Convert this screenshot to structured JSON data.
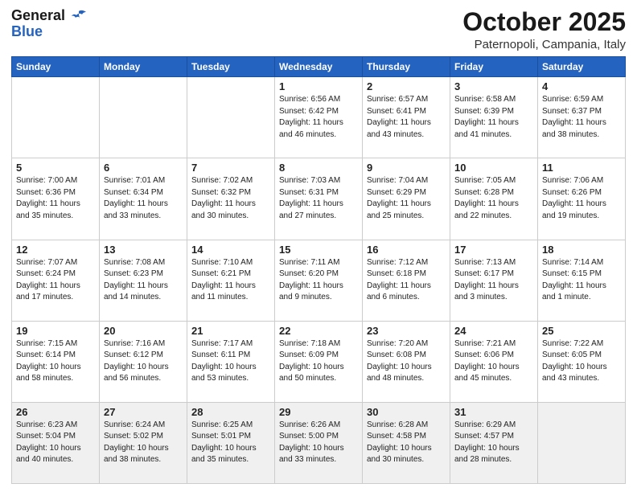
{
  "header": {
    "logo_general": "General",
    "logo_blue": "Blue",
    "month_title": "October 2025",
    "location": "Paternopoli, Campania, Italy"
  },
  "weekdays": [
    "Sunday",
    "Monday",
    "Tuesday",
    "Wednesday",
    "Thursday",
    "Friday",
    "Saturday"
  ],
  "weeks": [
    [
      {
        "day": "",
        "info": ""
      },
      {
        "day": "",
        "info": ""
      },
      {
        "day": "",
        "info": ""
      },
      {
        "day": "1",
        "info": "Sunrise: 6:56 AM\nSunset: 6:42 PM\nDaylight: 11 hours\nand 46 minutes."
      },
      {
        "day": "2",
        "info": "Sunrise: 6:57 AM\nSunset: 6:41 PM\nDaylight: 11 hours\nand 43 minutes."
      },
      {
        "day": "3",
        "info": "Sunrise: 6:58 AM\nSunset: 6:39 PM\nDaylight: 11 hours\nand 41 minutes."
      },
      {
        "day": "4",
        "info": "Sunrise: 6:59 AM\nSunset: 6:37 PM\nDaylight: 11 hours\nand 38 minutes."
      }
    ],
    [
      {
        "day": "5",
        "info": "Sunrise: 7:00 AM\nSunset: 6:36 PM\nDaylight: 11 hours\nand 35 minutes."
      },
      {
        "day": "6",
        "info": "Sunrise: 7:01 AM\nSunset: 6:34 PM\nDaylight: 11 hours\nand 33 minutes."
      },
      {
        "day": "7",
        "info": "Sunrise: 7:02 AM\nSunset: 6:32 PM\nDaylight: 11 hours\nand 30 minutes."
      },
      {
        "day": "8",
        "info": "Sunrise: 7:03 AM\nSunset: 6:31 PM\nDaylight: 11 hours\nand 27 minutes."
      },
      {
        "day": "9",
        "info": "Sunrise: 7:04 AM\nSunset: 6:29 PM\nDaylight: 11 hours\nand 25 minutes."
      },
      {
        "day": "10",
        "info": "Sunrise: 7:05 AM\nSunset: 6:28 PM\nDaylight: 11 hours\nand 22 minutes."
      },
      {
        "day": "11",
        "info": "Sunrise: 7:06 AM\nSunset: 6:26 PM\nDaylight: 11 hours\nand 19 minutes."
      }
    ],
    [
      {
        "day": "12",
        "info": "Sunrise: 7:07 AM\nSunset: 6:24 PM\nDaylight: 11 hours\nand 17 minutes."
      },
      {
        "day": "13",
        "info": "Sunrise: 7:08 AM\nSunset: 6:23 PM\nDaylight: 11 hours\nand 14 minutes."
      },
      {
        "day": "14",
        "info": "Sunrise: 7:10 AM\nSunset: 6:21 PM\nDaylight: 11 hours\nand 11 minutes."
      },
      {
        "day": "15",
        "info": "Sunrise: 7:11 AM\nSunset: 6:20 PM\nDaylight: 11 hours\nand 9 minutes."
      },
      {
        "day": "16",
        "info": "Sunrise: 7:12 AM\nSunset: 6:18 PM\nDaylight: 11 hours\nand 6 minutes."
      },
      {
        "day": "17",
        "info": "Sunrise: 7:13 AM\nSunset: 6:17 PM\nDaylight: 11 hours\nand 3 minutes."
      },
      {
        "day": "18",
        "info": "Sunrise: 7:14 AM\nSunset: 6:15 PM\nDaylight: 11 hours\nand 1 minute."
      }
    ],
    [
      {
        "day": "19",
        "info": "Sunrise: 7:15 AM\nSunset: 6:14 PM\nDaylight: 10 hours\nand 58 minutes."
      },
      {
        "day": "20",
        "info": "Sunrise: 7:16 AM\nSunset: 6:12 PM\nDaylight: 10 hours\nand 56 minutes."
      },
      {
        "day": "21",
        "info": "Sunrise: 7:17 AM\nSunset: 6:11 PM\nDaylight: 10 hours\nand 53 minutes."
      },
      {
        "day": "22",
        "info": "Sunrise: 7:18 AM\nSunset: 6:09 PM\nDaylight: 10 hours\nand 50 minutes."
      },
      {
        "day": "23",
        "info": "Sunrise: 7:20 AM\nSunset: 6:08 PM\nDaylight: 10 hours\nand 48 minutes."
      },
      {
        "day": "24",
        "info": "Sunrise: 7:21 AM\nSunset: 6:06 PM\nDaylight: 10 hours\nand 45 minutes."
      },
      {
        "day": "25",
        "info": "Sunrise: 7:22 AM\nSunset: 6:05 PM\nDaylight: 10 hours\nand 43 minutes."
      }
    ],
    [
      {
        "day": "26",
        "info": "Sunrise: 6:23 AM\nSunset: 5:04 PM\nDaylight: 10 hours\nand 40 minutes."
      },
      {
        "day": "27",
        "info": "Sunrise: 6:24 AM\nSunset: 5:02 PM\nDaylight: 10 hours\nand 38 minutes."
      },
      {
        "day": "28",
        "info": "Sunrise: 6:25 AM\nSunset: 5:01 PM\nDaylight: 10 hours\nand 35 minutes."
      },
      {
        "day": "29",
        "info": "Sunrise: 6:26 AM\nSunset: 5:00 PM\nDaylight: 10 hours\nand 33 minutes."
      },
      {
        "day": "30",
        "info": "Sunrise: 6:28 AM\nSunset: 4:58 PM\nDaylight: 10 hours\nand 30 minutes."
      },
      {
        "day": "31",
        "info": "Sunrise: 6:29 AM\nSunset: 4:57 PM\nDaylight: 10 hours\nand 28 minutes."
      },
      {
        "day": "",
        "info": ""
      }
    ]
  ]
}
